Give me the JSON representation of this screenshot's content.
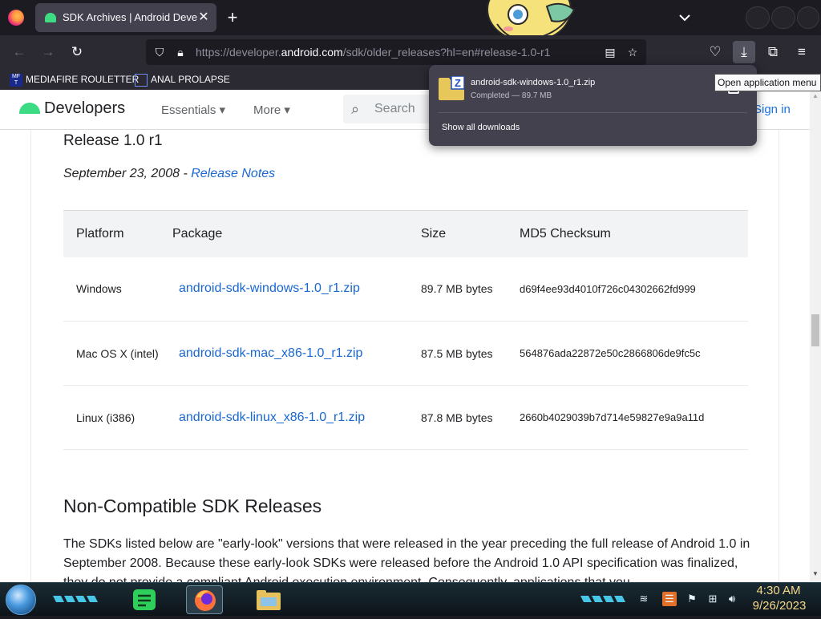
{
  "browser": {
    "tab_title": "SDK Archives  |  Android Developers",
    "tab_close": "✕",
    "new_tab": "+",
    "url_host_prefix": "https://developer.",
    "url_host_main": "android.com",
    "url_path": "/sdk/older_releases?hl=en#release-1.0-r1",
    "tooltip": "Open application menu"
  },
  "bookmarks": [
    {
      "label": "MEDIAFIRE ROULETTER",
      "icon": "mediafire-icon"
    },
    {
      "label": "ANAL PROLAPSE",
      "icon": "bookmark-folder-icon"
    }
  ],
  "downloads_panel": {
    "file_name": "android-sdk-windows-1.0_r1.zip",
    "status": "Completed — 89.7 MB",
    "show_all": "Show all downloads"
  },
  "site": {
    "brand": "Developers",
    "nav": [
      "Essentials",
      "More"
    ],
    "search_placeholder": "Search",
    "sign_in": "Sign in"
  },
  "release": {
    "title": "Release 1.0 r1",
    "date": "September 23, 2008 - ",
    "notes_link": "Release Notes"
  },
  "table": {
    "headers": [
      "Platform",
      "Package",
      "Size",
      "MD5 Checksum"
    ],
    "rows": [
      {
        "platform": "Windows",
        "package": "android-sdk-windows-1.0_r1.zip",
        "size": "89.7 MB bytes",
        "md5": "d69f4ee93d4010f726c04302662fd999"
      },
      {
        "platform": "Mac OS X (intel)",
        "package": "android-sdk-mac_x86-1.0_r1.zip",
        "size": "87.5 MB bytes",
        "md5": "564876ada22872e50c2866806de9fc5c"
      },
      {
        "platform": "Linux (i386)",
        "package": "android-sdk-linux_x86-1.0_r1.zip",
        "size": "87.8 MB bytes",
        "md5": "2660b4029039b7d714e59827e9a9a11d"
      }
    ]
  },
  "noncompat": {
    "heading": "Non-Compatible SDK Releases",
    "paragraph": "The SDKs listed below are \"early-look\" versions that were released in the year preceding the full release of Android 1.0 in September 2008. Because these early-look SDKs were released before the Android 1.0 API specification was finalized, they do not provide a compliant Android execution environment. Consequently, applications that you"
  },
  "taskbar": {
    "time": "4:30 AM",
    "date": "9/26/2023"
  },
  "colors": {
    "link": "#1967d2",
    "android_green": "#3ddc84",
    "browser_chrome": "#2b2a33",
    "clock": "#f6d98a"
  }
}
